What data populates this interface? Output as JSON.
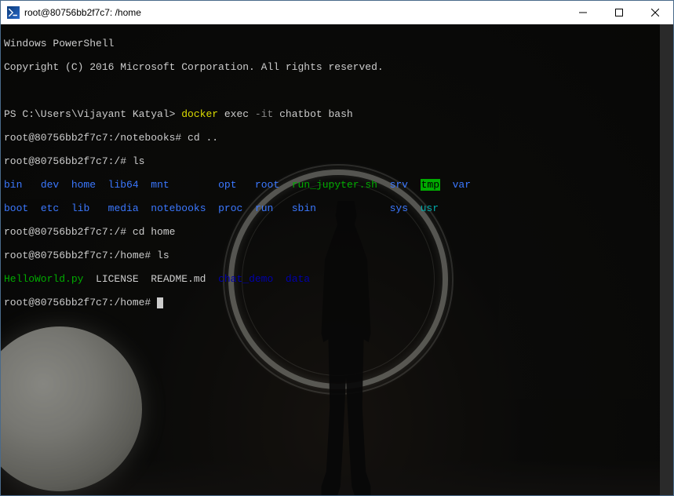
{
  "window": {
    "title": "root@80756bb2f7c7: /home",
    "icon_label": "PowerShell"
  },
  "header": {
    "line1": "Windows PowerShell",
    "line2": "Copyright (C) 2016 Microsoft Corporation. All rights reserved."
  },
  "lines": {
    "prompt_ps": "PS C:\\Users\\Vijayant Katyal> ",
    "cmd_docker": "docker ",
    "cmd_exec": "exec ",
    "cmd_it": "-it ",
    "cmd_args": "chatbot bash",
    "p_notebooks": "root@80756bb2f7c7:/notebooks# ",
    "cmd_cd_up": "cd ..",
    "p_root": "root@80756bb2f7c7:/# ",
    "cmd_ls": "ls",
    "p_home": "root@80756bb2f7c7:/home# ",
    "cmd_cd_home": "cd home",
    "final_prompt": "root@80756bb2f7c7:/home#"
  },
  "ls_root": {
    "bin": "bin",
    "dev": "dev",
    "home": "home",
    "lib64": "lib64",
    "mnt": "mnt",
    "opt": "opt",
    "root": "root",
    "run_jupyter": "run_jupyter.sh",
    "srv": "srv",
    "tmp": "tmp",
    "var": "var",
    "boot": "boot",
    "etc": "etc",
    "lib": "lib",
    "media": "media",
    "notebooks": "notebooks",
    "proc": "proc",
    "run": "run",
    "sbin": "sbin",
    "sys": "sys",
    "usr": "usr"
  },
  "ls_home": {
    "helloworld": "HelloWorld.py",
    "license": "LICENSE",
    "readme": "README.md",
    "chat_demo": "chat_demo",
    "data": "data"
  }
}
